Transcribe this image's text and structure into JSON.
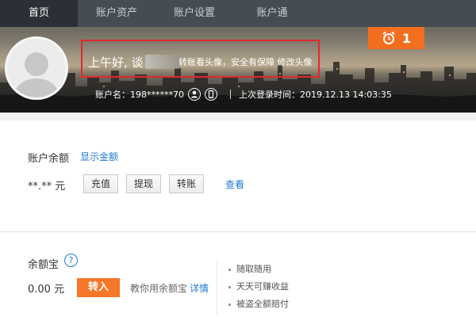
{
  "nav": {
    "tabs": [
      {
        "label": "首页"
      },
      {
        "label": "账户资产"
      },
      {
        "label": "账户设置"
      },
      {
        "label": "账户通"
      }
    ]
  },
  "banner": {
    "greeting": "上午好, 谈",
    "security_tip": "转账看头像，安全有保障 修改头像",
    "alarm_count": "1",
    "account_name_label": "账户名：",
    "account_name_value": "198******70",
    "last_login_label": "上次登录时间：",
    "last_login_value": "2019.12.13 14:03:35",
    "accent_color": "#f26f20",
    "highlight_color": "#e4272d"
  },
  "balance": {
    "label": "账户余额",
    "show_link": "显示金额",
    "masked_value": "**.** 元",
    "buttons": {
      "recharge": "充值",
      "withdraw": "提现",
      "transfer": "转账"
    },
    "view_link": "查看"
  },
  "yuebao": {
    "label": "余额宝",
    "help_icon": "?",
    "value": "0.00 元",
    "transfer_in": "转入",
    "teach_text": "教你用余额宝",
    "detail_link": "详情",
    "features": [
      "随取随用",
      "天天可赚收益",
      "被盗全额赔付"
    ]
  },
  "icons": {
    "alarm": "alarm-clock-icon",
    "avatar": "default-avatar",
    "person": "person-icon",
    "phone": "phone-icon",
    "help": "question-icon"
  }
}
